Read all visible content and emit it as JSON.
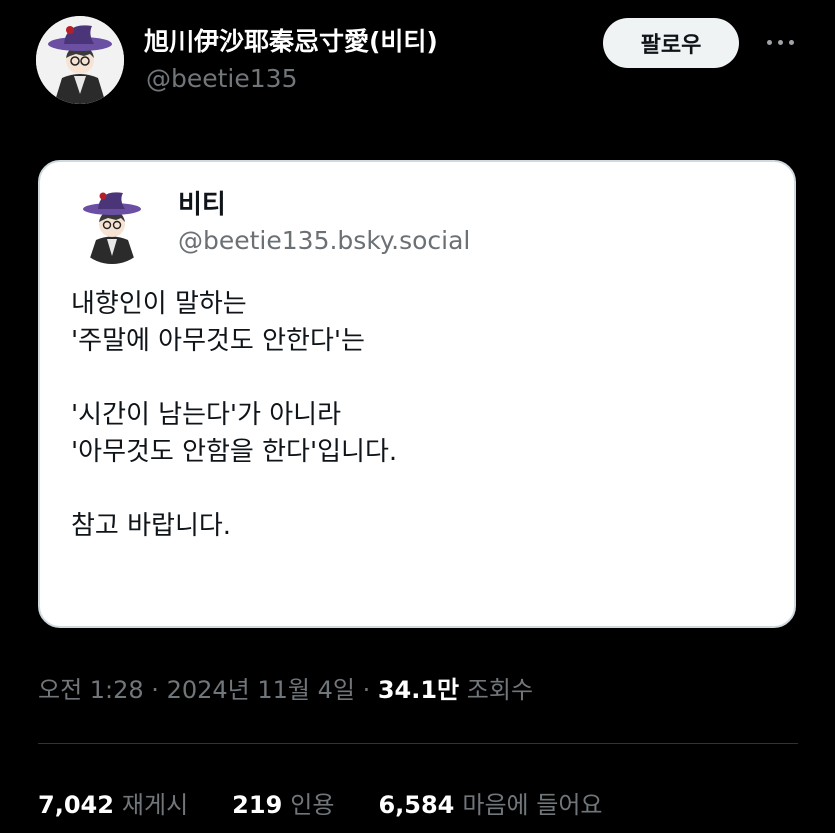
{
  "tweet": {
    "author": {
      "display_name": "旭川伊沙耶秦忌寸愛(비티)",
      "handle": "@beetie135"
    },
    "follow_label": "팔로우",
    "more_icon": "more-horizontal-icon",
    "quote": {
      "name": "비티",
      "handle": "@beetie135.bsky.social",
      "lines": [
        "내향인이 말하는",
        "'주말에 아무것도 안한다'는",
        "",
        "'시간이 남는다'가 아니라",
        "'아무것도 안함을 한다'입니다.",
        "",
        "참고 바랍니다."
      ]
    },
    "timestamp": "오전 1:28 · 2024년 11월 4일 · ",
    "views_count": "34.1만",
    "views_label": "조회수",
    "stats": {
      "reposts": {
        "count": "7,042",
        "label": "재게시"
      },
      "quotes": {
        "count": "219",
        "label": "인용"
      },
      "likes": {
        "count": "6,584",
        "label": "마음에 들어요"
      }
    }
  },
  "colors": {
    "background": "#000000",
    "card": "#ffffff",
    "muted": "#71767b",
    "follow_button": "#eff3f4"
  }
}
